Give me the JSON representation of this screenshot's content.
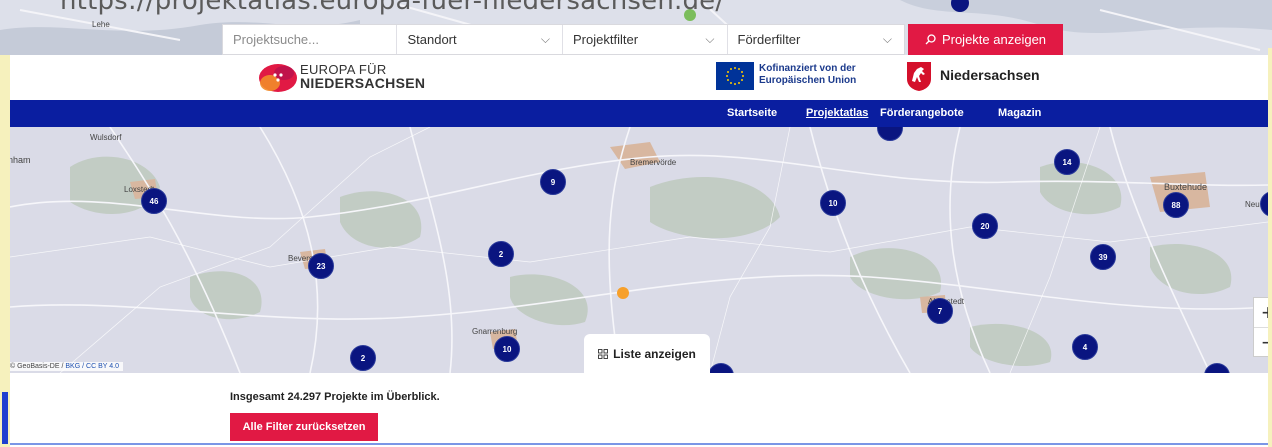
{
  "overlay_url": "https://projektatlas.europa-fuer-niedersachsen.de/",
  "search": {
    "placeholder": "Projektsuche...",
    "standort_label": "Standort",
    "projektfilter_label": "Projektfilter",
    "foerderfilter_label": "Förderfilter",
    "submit_label": "Projekte anzeigen"
  },
  "header": {
    "logo_line1": "EUROPA FÜR",
    "logo_line2": "NIEDERSACHSEN",
    "eu_line1": "Kofinanziert von der",
    "eu_line2": "Europäischen Union",
    "nds_label": "Niedersachsen"
  },
  "nav": {
    "items": [
      "Startseite",
      "Projektatlas",
      "Förderangebote",
      "Magazin"
    ],
    "active": "Projektatlas"
  },
  "map": {
    "places": [
      "Wulsdorf",
      "nham",
      "Loxstedt",
      "Bremervörde",
      "Buxtehude",
      "Neu Wulmst",
      "Beverstedt",
      "Gnarrenburg",
      "Ahlerstedt",
      "Lehe"
    ],
    "clusters": [
      "46",
      "9",
      "10",
      "14",
      "88",
      "20",
      "23",
      "2",
      "39",
      "7",
      "2",
      "10",
      "4"
    ],
    "zoom_in": "+",
    "zoom_out": "−",
    "attribution_prefix": "© GeoBasis-DE /",
    "attribution_bkg": "BKG",
    "attribution_sep": "/",
    "attribution_license": "CC BY 4.0",
    "list_button": "Liste anzeigen"
  },
  "summary": {
    "total_text": "Insgesamt 24.297 Projekte im Überblick.",
    "reset_label": "Alle Filter zurücksetzen"
  },
  "colors": {
    "brand_red": "#e11944",
    "nav_blue": "#0a1ea0",
    "cluster_navy": "#0a1580",
    "marker_orange": "#f7a02b"
  }
}
